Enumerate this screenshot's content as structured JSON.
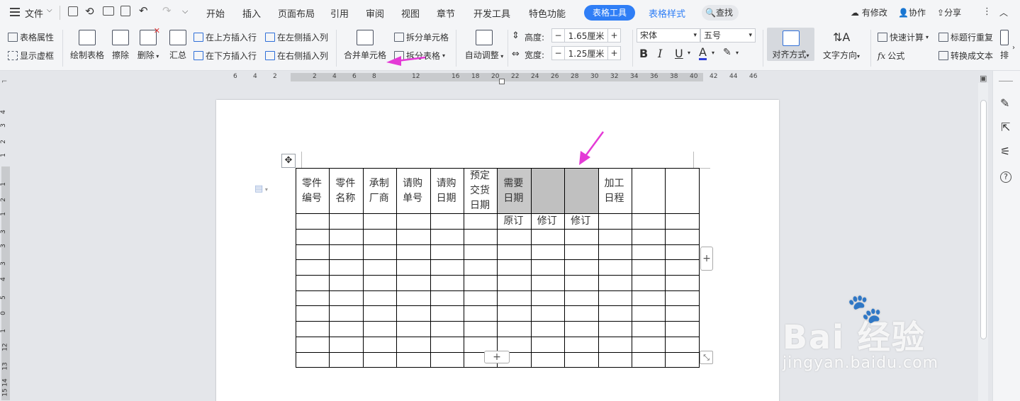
{
  "topbar": {
    "file_label": "文件",
    "tabs": [
      "开始",
      "插入",
      "页面布局",
      "引用",
      "审阅",
      "视图",
      "章节",
      "开发工具",
      "特色功能"
    ],
    "active_tab": "表格工具",
    "style_tab": "表格样式",
    "search_label": "查找",
    "right": {
      "changes": "有修改",
      "collab": "协作",
      "share": "分享"
    }
  },
  "ribbon": {
    "table_props": "表格属性",
    "show_gridlines": "显示虚框",
    "draw_table": "绘制表格",
    "erase": "擦除",
    "delete": "删除",
    "summary": "汇总",
    "insert_above": "在上方插入行",
    "insert_below": "在下方插入行",
    "insert_left": "在左侧插入列",
    "insert_right": "在右侧插入列",
    "merge_cells": "合并单元格",
    "split_cells": "拆分单元格",
    "split_table": "拆分表格",
    "auto_fit": "自动调整",
    "height_label": "高度:",
    "height_value": "1.65厘米",
    "width_label": "宽度:",
    "width_value": "1.25厘米",
    "font_name": "宋体",
    "font_size": "五号",
    "bold": "B",
    "italic": "I",
    "underline": "U",
    "font_color": "A",
    "align": "对齐方式",
    "text_direction": "文字方向",
    "quick_calc": "快速计算",
    "formula": "公式",
    "repeat_header": "标题行重复",
    "to_text": "转换成文本",
    "sort": "排"
  },
  "ruler": {
    "h_ticks": [
      "6",
      "4",
      "2",
      "2",
      "4",
      "6",
      "8",
      "12",
      "16",
      "18",
      "20",
      "22",
      "24",
      "26",
      "28",
      "30",
      "32",
      "34",
      "36",
      "38",
      "40",
      "42",
      "44",
      "46"
    ],
    "v_ticks": [
      "4",
      "3",
      "2",
      "1",
      "1",
      "2",
      "1",
      "3",
      "3",
      "3",
      "4",
      "5",
      "0",
      "1",
      "12",
      "13",
      "14",
      "15"
    ]
  },
  "table": {
    "header": [
      "零件\n编号",
      "零件\n名称",
      "承制\n厂商",
      "请购\n单号",
      "请购\n日期",
      "预定\n交货\n日期",
      "需要\n日期",
      "",
      "",
      "加工\n日程",
      "",
      ""
    ],
    "subheader": [
      "",
      "",
      "",
      "",
      "",
      "",
      "原订",
      "修订",
      "修订",
      "",
      "",
      ""
    ],
    "empty_rows": 9
  },
  "watermark": {
    "brand": "Bai  经验",
    "url": "jingyan.baidu.com"
  },
  "colors": {
    "accent": "#2f7ef6",
    "highlight": "#c0c0c0",
    "arrow": "#e43ad6"
  }
}
